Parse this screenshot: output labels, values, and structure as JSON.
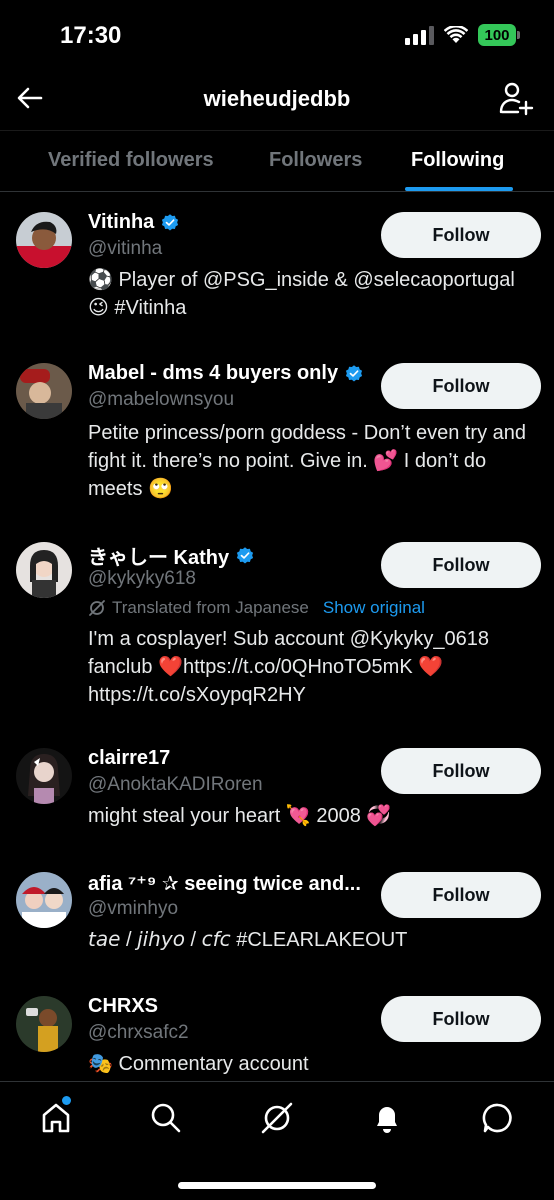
{
  "status": {
    "time": "17:30",
    "battery": "100"
  },
  "header": {
    "title": "wieheudjedbb",
    "back_icon": "arrow-left-icon",
    "add_icon": "add-user-icon"
  },
  "tabs": [
    {
      "label": "Verified followers",
      "active": false
    },
    {
      "label": "Followers",
      "active": false
    },
    {
      "label": "Following",
      "active": true
    }
  ],
  "users": [
    {
      "name": "Vitinha",
      "handle": "@vitinha",
      "verified": true,
      "bio": "⚽ Player of @PSG_inside & @selecaoportugal 😉 #Vitinha",
      "follow_label": "Follow"
    },
    {
      "name": "Mabel - dms 4 buyers only",
      "handle": "@mabelownsyou",
      "verified": true,
      "bio": "Petite princess/porn goddess - Don’t even try and fight it. there’s no point. Give in. 💕 I don’t do meets 🙄",
      "follow_label": "Follow"
    },
    {
      "name": "きゃしー Kathy",
      "handle": "@kykyky618",
      "verified": true,
      "translated": "Translated from Japanese",
      "show_original": "Show original",
      "bio": "I'm a cosplayer! Sub account @Kykyky_0618 fanclub ❤️https://t.co/0QHnoTO5mK ❤️https://t.co/sXoypqR2HY",
      "follow_label": "Follow"
    },
    {
      "name": "clairre17",
      "handle": "@AnoktaKADIRoren",
      "verified": false,
      "bio": "might steal your heart 💘 2008 💞",
      "follow_label": "Follow"
    },
    {
      "name": "afia ⁷⁺⁹ ✰ seeing twice and...",
      "handle": "@vminhyo",
      "verified": false,
      "bio": "𝘵𝘢𝘦 / 𝘫𝘪𝘩𝘺𝘰 / 𝘤𝘧𝘤 #CLEARLAKEOUT",
      "follow_label": "Follow"
    },
    {
      "name": "CHRXS",
      "handle": "@chrxsafc2",
      "verified": false,
      "bio": "🎭 Commentary account",
      "follow_label": "Follow"
    }
  ],
  "nav": [
    {
      "icon": "home-icon"
    },
    {
      "icon": "search-icon"
    },
    {
      "icon": "grok-icon"
    },
    {
      "icon": "bell-icon"
    },
    {
      "icon": "messages-icon"
    }
  ],
  "colors": {
    "accent": "#1d9bf0",
    "background": "#000000",
    "button": "#eff3f4"
  }
}
